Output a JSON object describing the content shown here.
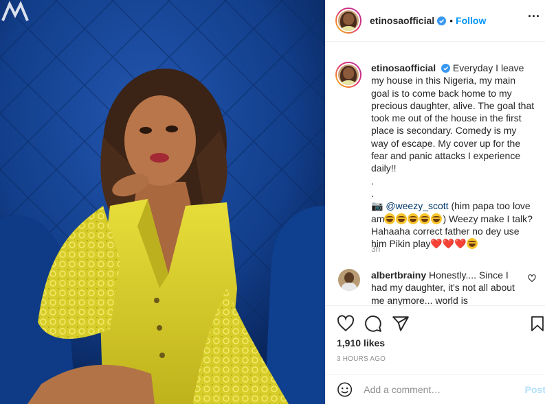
{
  "header": {
    "username": "etinosaofficial",
    "separator": "•",
    "follow_label": "Follow"
  },
  "caption": {
    "username": "etinosaofficial",
    "text_1": "Everyday I leave my house in this Nigeria, my main goal is to come back home to my precious daughter, alive. The goal that took me out of the house in the first place is secondary. Comedy is my way of escape. My cover up for the fear and panic attacks I experience daily!!",
    "dot_1": ".",
    "dot_2": ".",
    "camera": "📷",
    "mention": "@weezy_scott",
    "text_2": "(him papa too love am",
    "text_3": ") Weezy make I talk? Hahaaha correct father no dey use him Pikin play",
    "age": "3h"
  },
  "comment": {
    "username": "albertbrainy",
    "text": "Honestly.... Since I had my daughter, it's not all about me anymore... world is"
  },
  "actions": {
    "likes": "1,910 likes",
    "time": "3 HOURS AGO"
  },
  "add_comment": {
    "placeholder": "Add a comment…",
    "post_label": "Post"
  },
  "colors": {
    "link_blue": "#0095f6",
    "post_disabled": "#b2dffc",
    "muted": "#8e8e8e",
    "photo_blue": "#123e8a",
    "dress_yellow": "#d9d02a"
  }
}
